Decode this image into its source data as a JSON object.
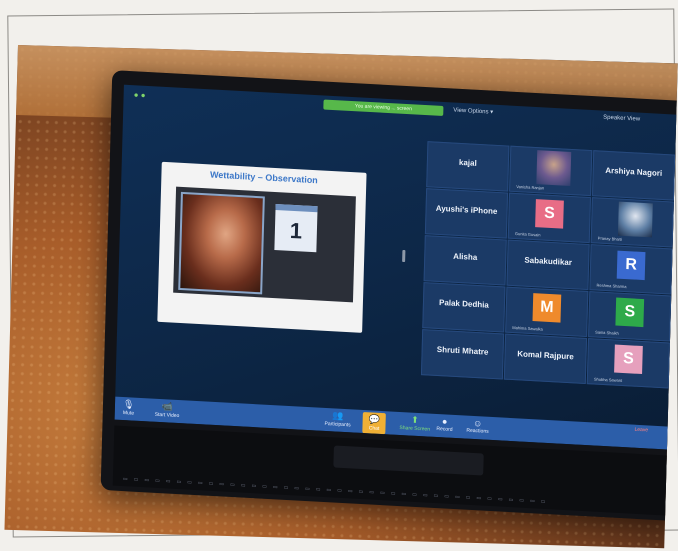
{
  "zoom": {
    "banner": "You are viewing ... screen",
    "view_options": "View Options ▾",
    "speaker_view": "Speaker View",
    "slide": {
      "title": "Wettability – Observation",
      "number": "1"
    },
    "participants": [
      {
        "name": "kajal",
        "style": "name"
      },
      {
        "name": "",
        "style": "photo",
        "caption": "Vanisha Ranjan"
      },
      {
        "name": "Arshiya Nagori",
        "style": "name"
      },
      {
        "name": "Ayushi's iPhone",
        "style": "name"
      },
      {
        "name": "S",
        "style": "avatar",
        "color": "#e86d86",
        "caption": "Gunita Gusain"
      },
      {
        "name": "",
        "style": "photo2",
        "caption": "Pranay Bharti"
      },
      {
        "name": "Alisha",
        "style": "name"
      },
      {
        "name": "Sabakudikar",
        "style": "name"
      },
      {
        "name": "R",
        "style": "avatar",
        "color": "#3a6ad0",
        "caption": "Reshma Sharma"
      },
      {
        "name": "Palak Dedhia",
        "style": "name"
      },
      {
        "name": "M",
        "style": "avatar",
        "color": "#ef8a2c",
        "caption": "Mahima Sawalka"
      },
      {
        "name": "S",
        "style": "avatar",
        "color": "#2eaa4a",
        "caption": "Sania Shaikh"
      },
      {
        "name": "Shruti Mhatre",
        "style": "name"
      },
      {
        "name": "Komal Rajpure",
        "style": "name"
      },
      {
        "name": "S",
        "style": "avatar",
        "color": "#e6a0bd",
        "caption": "Shubha Sawant"
      }
    ],
    "toolbar": {
      "mute": "Mute",
      "video": "Start Video",
      "participants": "Participants",
      "participants_count": "20",
      "chat": "Chat",
      "share": "Share Screen",
      "record": "Record",
      "reactions": "Reactions",
      "leave": "Leave"
    }
  }
}
